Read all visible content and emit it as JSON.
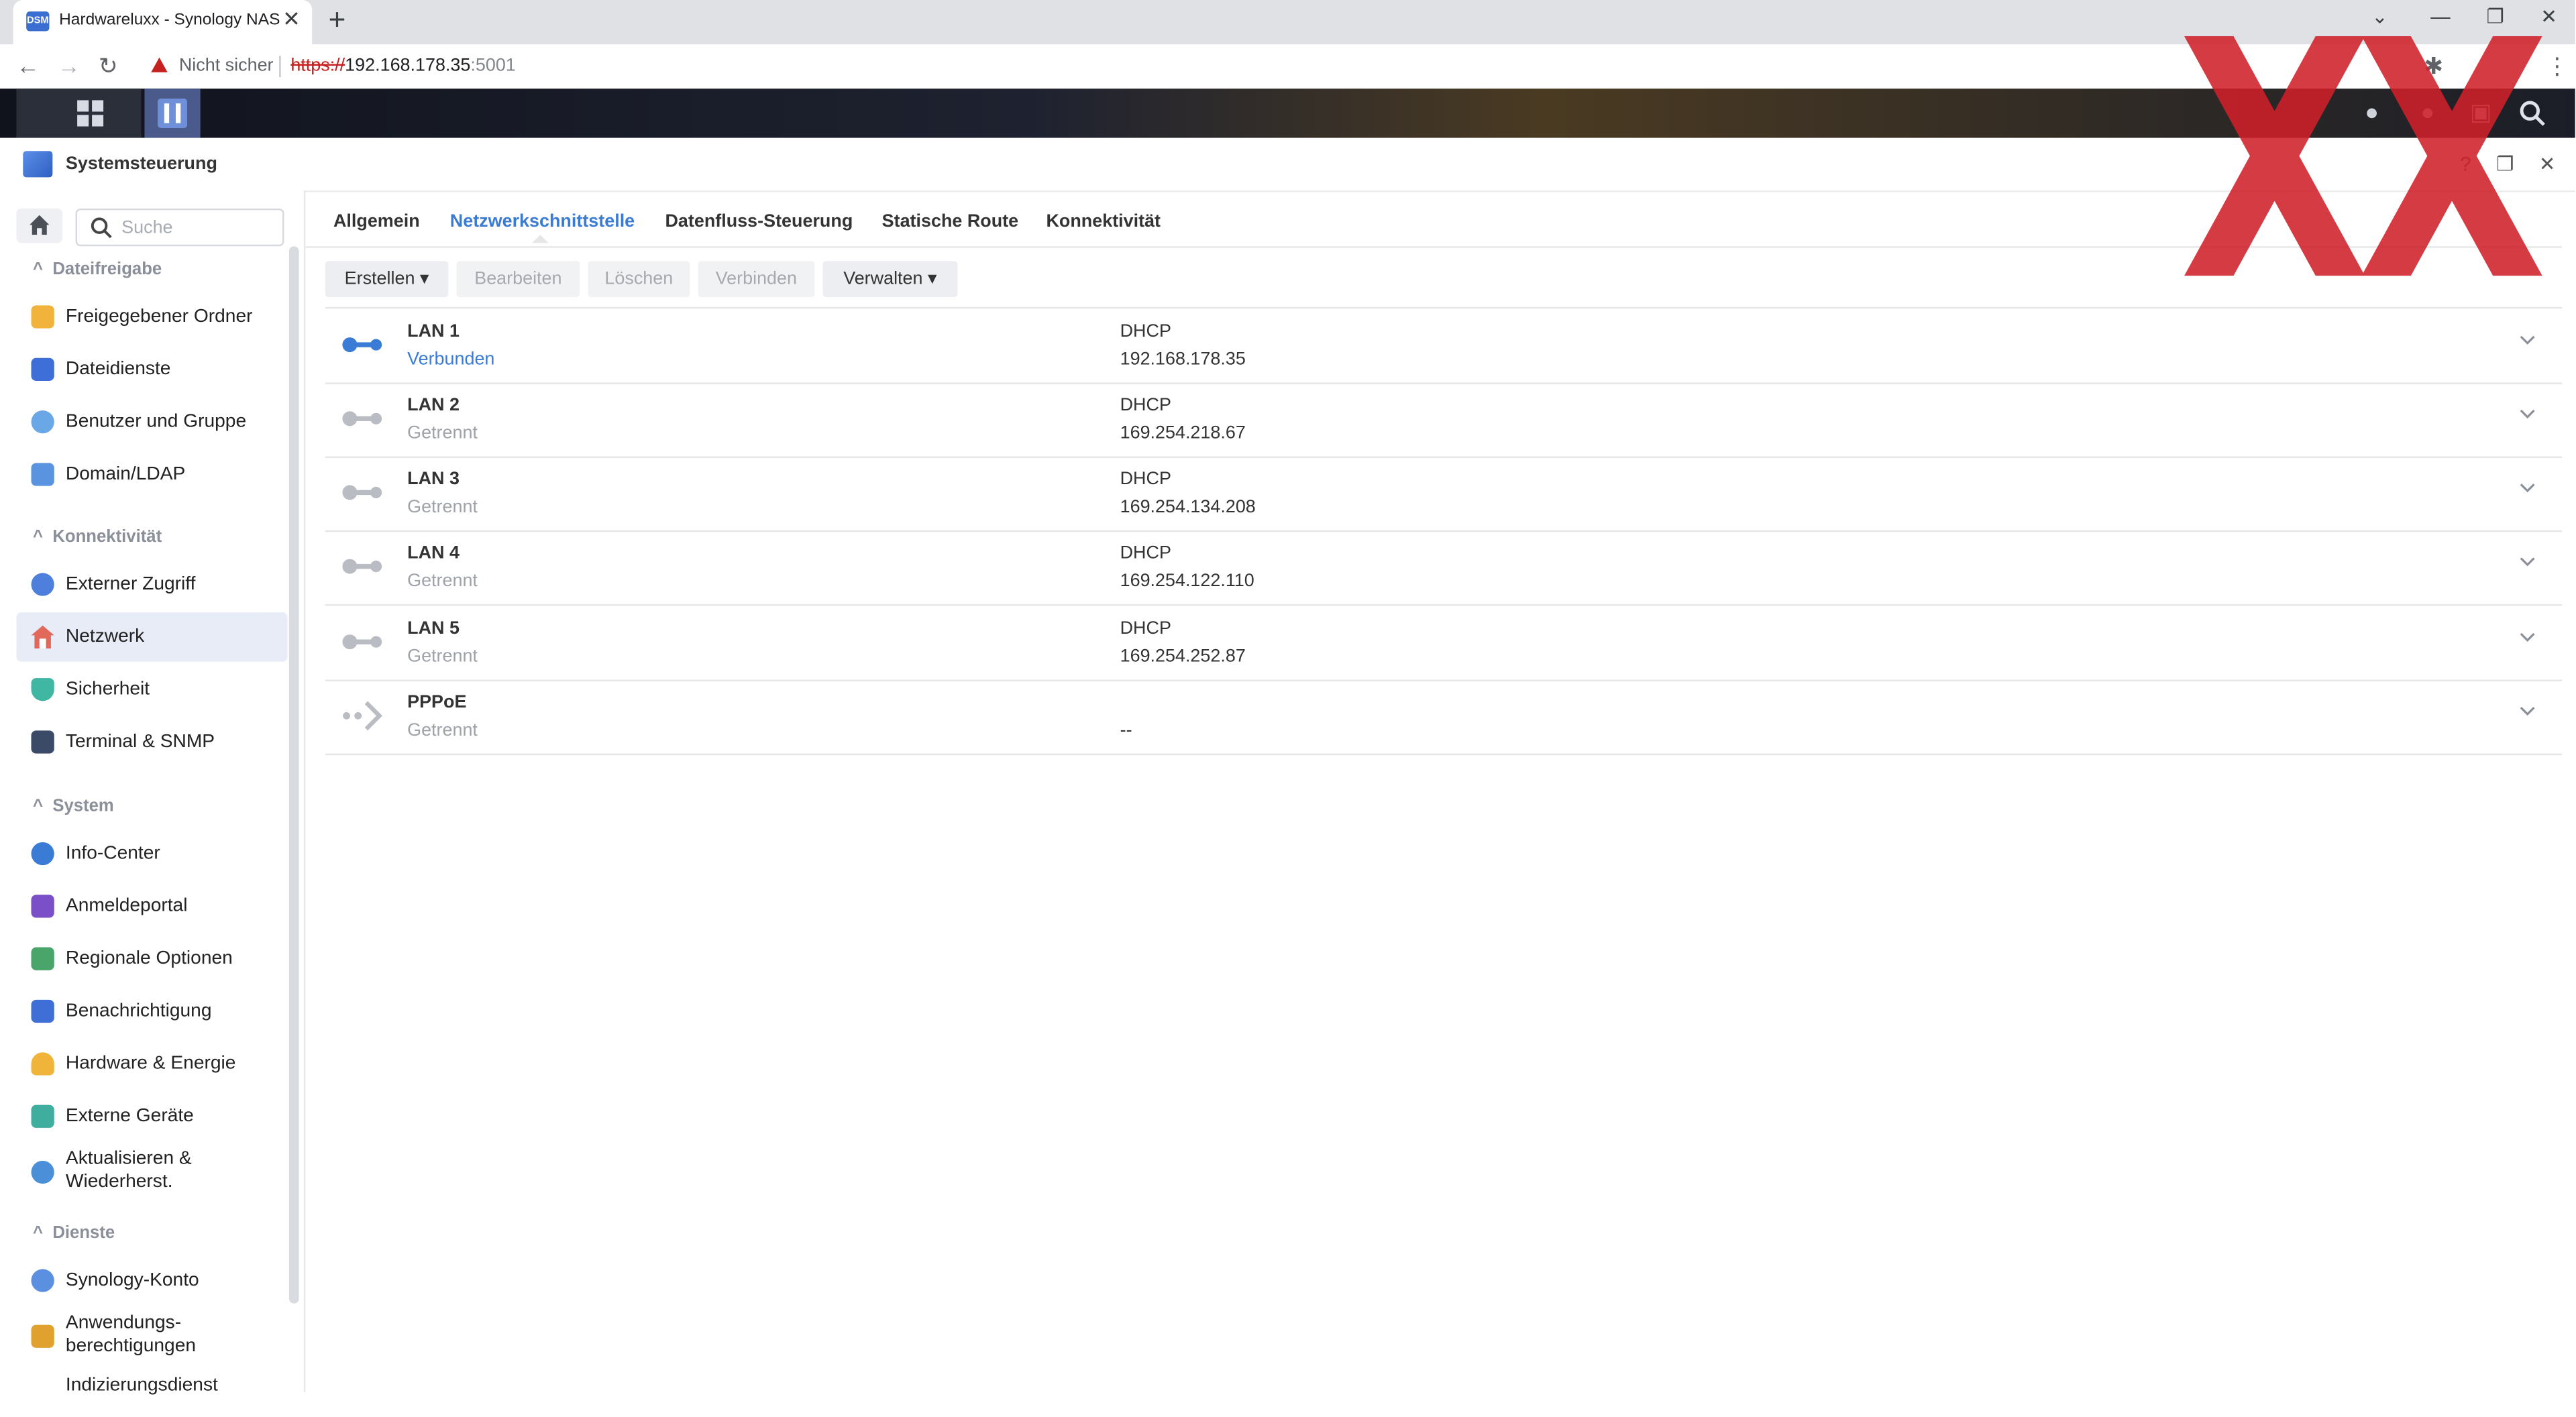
{
  "browser": {
    "tab_title": "Hardwareluxx - Synology NAS",
    "favicon_text": "DSM",
    "security_label": "Nicht sicher",
    "url_scheme": "https://",
    "url_host": "192.168.178.35",
    "url_port": ":5001"
  },
  "window": {
    "title": "Systemsteuerung"
  },
  "sidebar": {
    "search_placeholder": "Suche",
    "sections": [
      {
        "title": "Dateifreigabe",
        "items": [
          "Freigegebener Ordner",
          "Dateidienste",
          "Benutzer und Gruppe",
          "Domain/LDAP"
        ]
      },
      {
        "title": "Konnektivität",
        "items": [
          "Externer Zugriff",
          "Netzwerk",
          "Sicherheit",
          "Terminal & SNMP"
        ]
      },
      {
        "title": "System",
        "items": [
          "Info-Center",
          "Anmeldeportal",
          "Regionale Optionen",
          "Benachrichtigung",
          "Hardware & Energie",
          "Externe Geräte",
          "Aktualisieren &",
          "Wiederherst."
        ]
      },
      {
        "title": "Dienste",
        "items": [
          "Synology-Konto",
          "Anwendungs-",
          "berechtigungen",
          "Indizierungsdienst"
        ]
      }
    ],
    "active_item": "Netzwerk"
  },
  "tabs": [
    "Allgemein",
    "Netzwerkschnittstelle",
    "Datenfluss-Steuerung",
    "Statische Route",
    "Konnektivität"
  ],
  "active_tab": "Netzwerkschnittstelle",
  "toolbar": {
    "create": "Erstellen",
    "edit": "Bearbeiten",
    "delete": "Löschen",
    "connect": "Verbinden",
    "manage": "Verwalten"
  },
  "interfaces": [
    {
      "name": "LAN 1",
      "status": "Verbunden",
      "mode": "DHCP",
      "ip": "192.168.178.35",
      "connected": true
    },
    {
      "name": "LAN 2",
      "status": "Getrennt",
      "mode": "DHCP",
      "ip": "169.254.218.67",
      "connected": false
    },
    {
      "name": "LAN 3",
      "status": "Getrennt",
      "mode": "DHCP",
      "ip": "169.254.134.208",
      "connected": false
    },
    {
      "name": "LAN 4",
      "status": "Getrennt",
      "mode": "DHCP",
      "ip": "169.254.122.110",
      "connected": false
    },
    {
      "name": "LAN 5",
      "status": "Getrennt",
      "mode": "DHCP",
      "ip": "169.254.252.87",
      "connected": false
    },
    {
      "name": "PPPoE",
      "status": "Getrennt",
      "mode": "",
      "ip": "--",
      "connected": false
    }
  ],
  "colors": {
    "accent": "#3a7bd5",
    "logo_red": "#d0202a"
  }
}
